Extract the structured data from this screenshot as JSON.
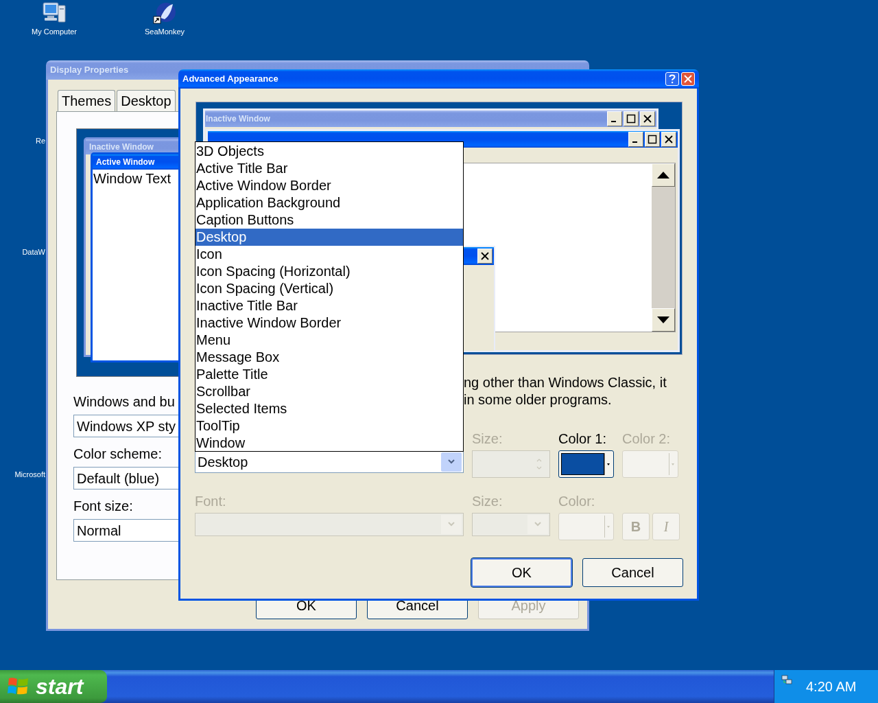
{
  "desktop": {
    "icons": [
      {
        "label": "My Computer",
        "kind": "computer"
      },
      {
        "label": "SeaMonkey",
        "kind": "browser"
      }
    ],
    "partial_labels": [
      "Re",
      "DataW",
      "Microsoft"
    ]
  },
  "display_properties": {
    "title": "Display Properties",
    "active": false,
    "tabs": [
      {
        "label": "Themes",
        "selected": false
      },
      {
        "label": "Desktop",
        "selected": false
      }
    ],
    "preview": {
      "inactive_title": "Inactive Window",
      "active_title": "Active Window",
      "window_text": "Window Text"
    },
    "fields": [
      {
        "label": "Windows and bu",
        "value": "Windows XP sty"
      },
      {
        "label": "Color scheme:",
        "value": "Default (blue)"
      },
      {
        "label": "Font size:",
        "value": "Normal"
      }
    ],
    "buttons": [
      {
        "label": "OK",
        "disabled": false
      },
      {
        "label": "Cancel",
        "disabled": false
      },
      {
        "label": "Apply",
        "disabled": true
      }
    ]
  },
  "advanced_appearance": {
    "title": "Advanced Appearance",
    "active": true,
    "preview": {
      "inactive_title": "Inactive Window"
    },
    "description": [
      "ng other than Windows Classic, it",
      "in some older programs."
    ],
    "item_list": [
      {
        "label": "3D Objects",
        "selected": false
      },
      {
        "label": "Active Title Bar",
        "selected": false
      },
      {
        "label": "Active Window Border",
        "selected": false
      },
      {
        "label": "Application Background",
        "selected": false
      },
      {
        "label": "Caption Buttons",
        "selected": false
      },
      {
        "label": "Desktop",
        "selected": true
      },
      {
        "label": "Icon",
        "selected": false
      },
      {
        "label": "Icon Spacing (Horizontal)",
        "selected": false
      },
      {
        "label": "Icon Spacing (Vertical)",
        "selected": false
      },
      {
        "label": "Inactive Title Bar",
        "selected": false
      },
      {
        "label": "Inactive Window Border",
        "selected": false
      },
      {
        "label": "Menu",
        "selected": false
      },
      {
        "label": "Message Box",
        "selected": false
      },
      {
        "label": "Palette Title",
        "selected": false
      },
      {
        "label": "Scrollbar",
        "selected": false
      },
      {
        "label": "Selected Items",
        "selected": false
      },
      {
        "label": "ToolTip",
        "selected": false
      },
      {
        "label": "Window",
        "selected": false
      }
    ],
    "item_value": "Desktop",
    "row_1": [
      {
        "label": "Size:",
        "kind": "spinner",
        "disabled": true
      },
      {
        "label": "Color 1:",
        "kind": "color",
        "disabled": false,
        "color": "#0a4ea2"
      },
      {
        "label": "Color 2:",
        "kind": "color",
        "disabled": true
      }
    ],
    "row_2": [
      {
        "label": "Font:",
        "kind": "combo",
        "disabled": true
      },
      {
        "label": "Size:",
        "kind": "combo",
        "disabled": true
      },
      {
        "label": "Color:",
        "kind": "color",
        "disabled": true
      },
      {
        "label": "B",
        "kind": "toggle",
        "disabled": true
      },
      {
        "label": "I",
        "kind": "toggle",
        "disabled": true
      }
    ],
    "buttons": [
      {
        "label": "OK",
        "default": true
      },
      {
        "label": "Cancel",
        "default": false
      }
    ]
  },
  "taskbar": {
    "start_label": "start",
    "clock": "4:20 AM"
  }
}
